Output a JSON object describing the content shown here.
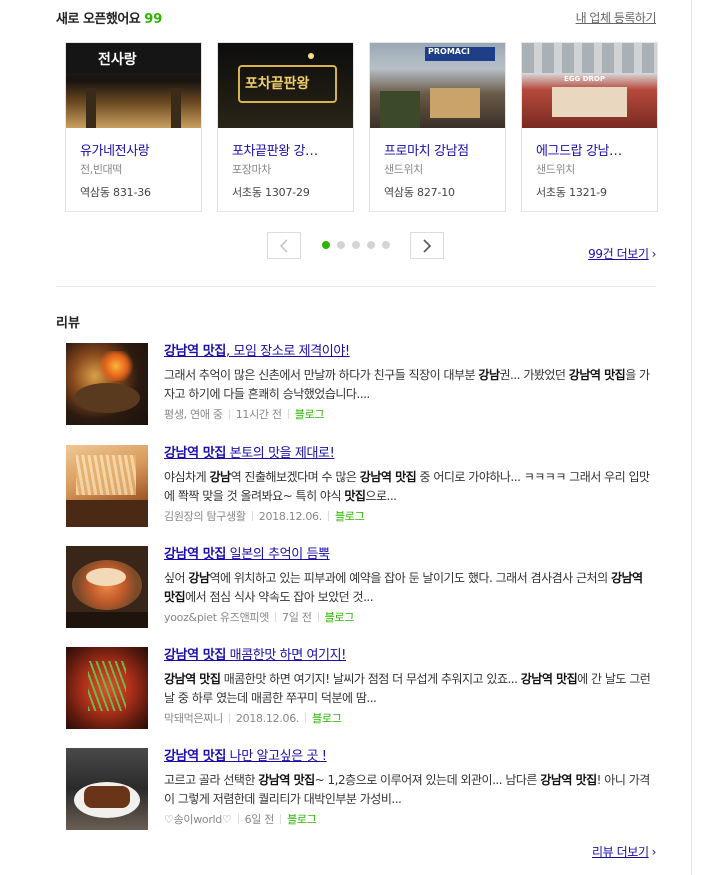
{
  "new_open": {
    "title": "새로 오픈했어요",
    "count": "99",
    "register_link": "내 업체 등록하기",
    "cards": [
      {
        "sign": "전사랑",
        "name": "유가네전사랑",
        "category": "전,빈대떡",
        "address": "역삼동 831-36"
      },
      {
        "sign": "포차끝판왕",
        "name": "포차끝판왕 강…",
        "category": "포장마차",
        "address": "서초동 1307-29"
      },
      {
        "sign": "PROMACI",
        "name": "프로마치 강남점",
        "category": "샌드위치",
        "address": "역삼동 827-10"
      },
      {
        "sign": "EGG DROP",
        "name": "에그드랍 강남…",
        "category": "샌드위치",
        "address": "서초동 1321-9"
      }
    ],
    "pager": {
      "prev_icon": "chevron-left-icon",
      "next_icon": "chevron-right-icon",
      "pages": 5,
      "current": 1
    },
    "more_link": "99건 더보기"
  },
  "reviews": {
    "title": "리뷰",
    "items": [
      {
        "title_hl": "강남역 맛집",
        "title_rest": ", 모임 장소로 제격이야!",
        "desc_html": "그래서 추억이 많은 신촌에서 만날까 하다가 친구들 직장이 대부분 <b>강남</b>권... 가봤었던 <b>강남역 맛집</b>을 가자고 하기에 다들 흔쾌히 승낙했었습니다....",
        "author": "평생, 연애 중",
        "time": "11시간 전",
        "source": "블로그"
      },
      {
        "title_hl": "강남역 맛집",
        "title_rest": " 본토의 맛을 제대로!",
        "desc_html": "야심차게 <b>강남</b>역 진출해보겠다며 수 많은 <b>강남역 맛집</b> 중 어디로 가야하나... ㅋㅋㅋㅋ 그래서 우리 입맛에 쫙짝 맞을 것 올려봐요~ 특히 야식 <b>맛집</b>으로...",
        "author": "김원장의 탐구생활",
        "time": "2018.12.06.",
        "source": "블로그"
      },
      {
        "title_hl": "강남역 맛집",
        "title_rest": " 일본의 추억이 듬뿍",
        "desc_html": "싶어 <b>강남</b>역에 위치하고 있는 피부과에 예약을 잡아 둔 날이기도 했다. 그래서 겸사겸사 근처의 <b>강남역 맛집</b>에서 점심 식사 약속도 잡아 보았던 것...",
        "author": "yooz&piet 유즈앤피엣",
        "time": "7일 전",
        "source": "블로그"
      },
      {
        "title_hl": "강남역 맛집",
        "title_rest": " 매콤한맛 하면 여기지!",
        "desc_html": "<b>강남역 맛집</b> 매콤한맛 하면 여기지! 날씨가 점점 더 무섭게 추워지고 있죠... <b>강남역 맛집</b>에 간 날도 그런 날 중 하루 였는데 매콤한 쭈꾸미 덕분에 땀...",
        "author": "막돼먹은찌니",
        "time": "2018.12.06.",
        "source": "블로그"
      },
      {
        "title_hl": "강남역 맛집",
        "title_rest": " 나만 알고싶은 곳 !",
        "desc_html": "고르고 골라 선택한 <b>강남역 맛집</b>~ 1,2층으로 이루어져 있는데 외관이... 남다른 <b>강남역 맛집</b>! 아니 가격이 그렇게 저렴한데 퀄리티가 대박인부분 가성비...",
        "author": "♡송이world♡",
        "time": "6일 전",
        "source": "블로그"
      }
    ],
    "more_link": "리뷰 더보기"
  },
  "colors": {
    "accent": "#2db400",
    "link": "#1a0dab"
  }
}
